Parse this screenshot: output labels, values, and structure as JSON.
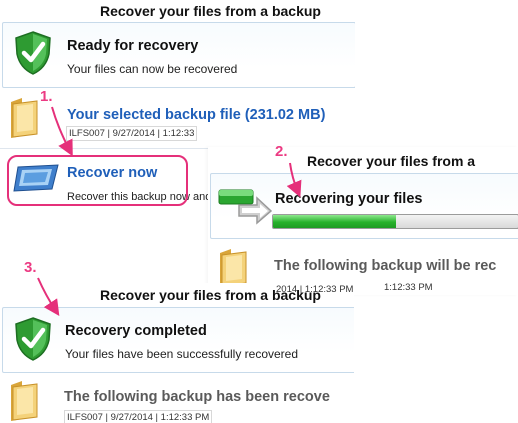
{
  "panel1": {
    "title": "Recover your files from a backup",
    "status_heading": "Ready for recovery",
    "status_sub": "Your files can now be recovered",
    "backup_file": "Your selected backup file (231.02 MB)",
    "backup_meta": "ILFS007 | 9/27/2014 | 1:12:33",
    "recover_label": "Recover now",
    "recover_desc": "Recover this backup now and"
  },
  "panel2": {
    "title": "Recover your files from a",
    "status_heading": "Recovering your files",
    "progress_fraction": 0.5,
    "following": "The following backup will be rec",
    "meta": "1:12:33 PM"
  },
  "panel3": {
    "title": "Recover your files from a backup",
    "status_heading": "Recovery completed",
    "status_sub": "Your files have been successfully recovered",
    "following": "The following backup has been recove",
    "meta_tail": "2014 | 1:12:33 PM",
    "meta": "ILFS007 | 9/27/2014 | 1:12:33 PM"
  },
  "steps": {
    "one": "1.",
    "two": "2.",
    "three": "3."
  },
  "icons": {
    "shield": "shield-check-icon",
    "folder": "folder-icon",
    "recover": "recover-drive-icon",
    "progress": "recovery-progress-icon"
  },
  "colors": {
    "accent": "#e5307a",
    "link": "#1f5fb9",
    "progress": "#27b22b"
  }
}
